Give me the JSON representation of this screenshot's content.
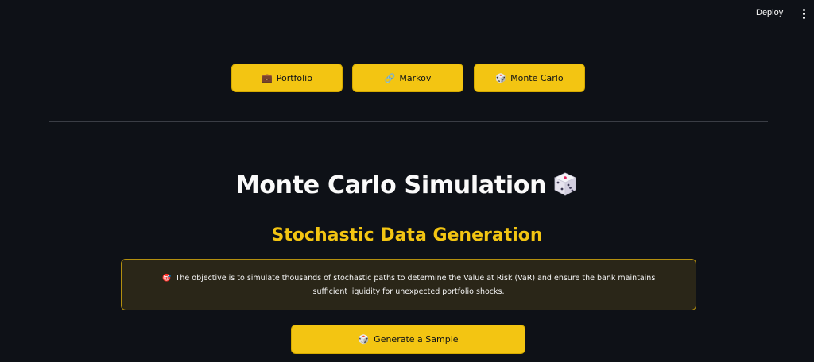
{
  "header": {
    "deploy_label": "Deploy",
    "menu_icon": "vertical-dots-icon"
  },
  "nav": {
    "items": [
      {
        "icon": "💼",
        "icon_name": "briefcase-icon",
        "label": "Portfolio"
      },
      {
        "icon": "🔗",
        "icon_name": "chain-icon",
        "label": "Markov"
      },
      {
        "icon": "🎲",
        "icon_name": "dice-icon",
        "label": "Monte Carlo"
      }
    ]
  },
  "main": {
    "title": "Monte Carlo Simulation",
    "title_icon": "dice-icon",
    "subtitle": "Stochastic Data Generation",
    "info": {
      "icon": "🎯",
      "icon_name": "target-icon",
      "text": "The objective is to simulate thousands of stochastic paths to determine the Value at Risk (VaR) and ensure the bank maintains sufficient liquidity for unexpected portfolio shocks."
    },
    "generate_button": {
      "icon": "🎲",
      "icon_name": "dice-icon",
      "label": "Generate a Sample"
    }
  },
  "colors": {
    "background": "#0e1117",
    "accent": "#f3c512",
    "info_border": "#b38f0f",
    "info_background": "#2a2618",
    "divider": "#3a3d45"
  }
}
